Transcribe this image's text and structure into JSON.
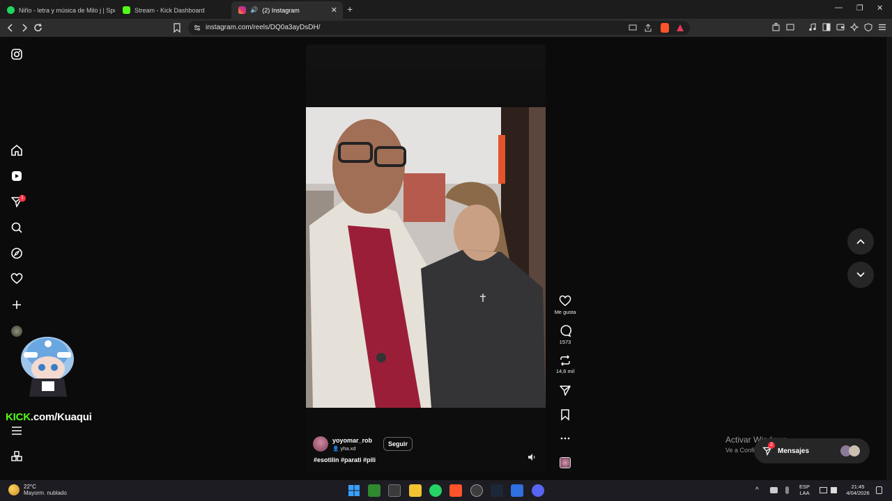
{
  "browser": {
    "tabs": [
      {
        "label": "Niño - letra y música de Milo j | Spot",
        "icon": "spotify-icon",
        "color": "#1ed760"
      },
      {
        "label": "Stream - Kick Dashboard",
        "icon": "kick-icon",
        "color": "#53fc18"
      },
      {
        "label": "(2) Instagram",
        "icon": "instagram-icon",
        "color": "#e1306c",
        "active": true
      }
    ],
    "new_tab": "+",
    "url": "instagram.com/reels/DQ0a3ayDsDH/"
  },
  "sidebar": {
    "icons": [
      "instagram-logo-icon",
      "home-icon",
      "reels-icon",
      "direct-icon",
      "search-icon",
      "explore-icon",
      "heart-icon",
      "create-icon",
      "profile-avatar-icon",
      "menu-icon",
      "more-apps-icon"
    ],
    "notification_badge": "1"
  },
  "overlay": {
    "kick_prefix": "KICK",
    "kick_suffix": ".com/Kuaqui"
  },
  "reel": {
    "author": "yoyomar_rob",
    "audio": "yha.xd",
    "follow_label": "Seguir",
    "caption": "#esotilin #parati #pili",
    "actions": {
      "like_label": "Me gusta",
      "comments_count": "1573",
      "reposts_count": "14,6 mil"
    }
  },
  "windows_watermark": {
    "title": "Activar Windows",
    "subtitle": "Ve a Configuración para activar Windows."
  },
  "messages": {
    "label": "Mensajes",
    "badge": "2"
  },
  "taskbar": {
    "weather_temp": "22°C",
    "weather_desc": "Mayorm. nublado",
    "lang_top": "ESP",
    "lang_bottom": "LAA",
    "time": "21:45",
    "date": "4/04/2026"
  }
}
